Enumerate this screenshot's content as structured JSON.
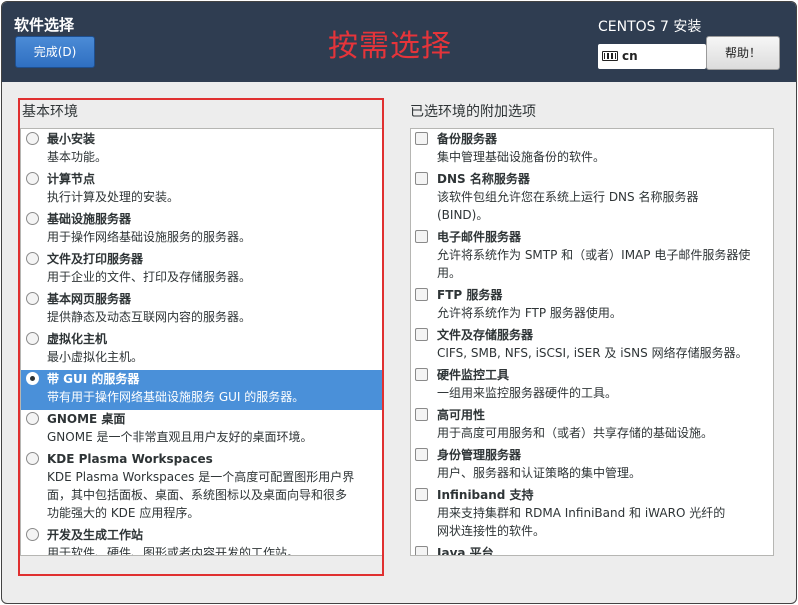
{
  "header": {
    "title": "软件选择",
    "done_label": "完成(D)",
    "annotation": "按需选择",
    "product": "CENTOS 7 安装",
    "keyboard_layout": "cn",
    "help_label": "帮助！"
  },
  "base_env": {
    "label": "基本环境",
    "items": [
      {
        "name": "最小安装",
        "desc": [
          "基本功能。"
        ],
        "selected": false
      },
      {
        "name": "计算节点",
        "desc": [
          "执行计算及处理的安装。"
        ],
        "selected": false
      },
      {
        "name": "基础设施服务器",
        "desc": [
          "用于操作网络基础设施服务的服务器。"
        ],
        "selected": false
      },
      {
        "name": "文件及打印服务器",
        "desc": [
          "用于企业的文件、打印及存储服务器。"
        ],
        "selected": false
      },
      {
        "name": "基本网页服务器",
        "desc": [
          "提供静态及动态互联网内容的服务器。"
        ],
        "selected": false
      },
      {
        "name": "虚拟化主机",
        "desc": [
          "最小虚拟化主机。"
        ],
        "selected": false
      },
      {
        "name": "带 GUI 的服务器",
        "desc": [
          "带有用于操作网络基础设施服务 GUI 的服务器。"
        ],
        "selected": true
      },
      {
        "name": "GNOME 桌面",
        "desc": [
          "GNOME 是一个非常直观且用户友好的桌面环境。"
        ],
        "selected": false
      },
      {
        "name": "KDE Plasma Workspaces",
        "desc": [
          "KDE Plasma Workspaces 是一个高度可配置图形用户界",
          "面，其中包括面板、桌面、系统图标以及桌面向导和很多",
          "功能强大的 KDE 应用程序。"
        ],
        "selected": false
      },
      {
        "name": "开发及生成工作站",
        "desc": [
          "用于软件、硬件、图形或者内容开发的工作站。"
        ],
        "selected": false
      }
    ]
  },
  "addons": {
    "label": "已选环境的附加选项",
    "items": [
      {
        "name": "备份服务器",
        "desc": [
          "集中管理基础设施备份的软件。"
        ]
      },
      {
        "name": "DNS 名称服务器",
        "desc": [
          "该软件包组允许您在系统上运行 DNS 名称服务器",
          "(BIND)。"
        ]
      },
      {
        "name": "电子邮件服务器",
        "desc": [
          "允许将系统作为 SMTP 和（或者）IMAP 电子邮件服务器使",
          "用。"
        ]
      },
      {
        "name": "FTP 服务器",
        "desc": [
          "允许将系统作为 FTP 服务器使用。"
        ]
      },
      {
        "name": "文件及存储服务器",
        "desc": [
          "CIFS, SMB, NFS, iSCSI, iSER 及 iSNS 网络存储服务器。"
        ]
      },
      {
        "name": "硬件监控工具",
        "desc": [
          "一组用来监控服务器硬件的工具。"
        ]
      },
      {
        "name": "高可用性",
        "desc": [
          "用于高度可用服务和（或者）共享存储的基础设施。"
        ]
      },
      {
        "name": "身份管理服务器",
        "desc": [
          "用户、服务器和认证策略的集中管理。"
        ]
      },
      {
        "name": "Infiniband 支持",
        "desc": [
          "用来支持集群和 RDMA InfiniBand 和 iWARO 光纤的",
          "网状连接性的软件。"
        ]
      },
      {
        "name": "Java 平台",
        "desc": []
      }
    ]
  }
}
